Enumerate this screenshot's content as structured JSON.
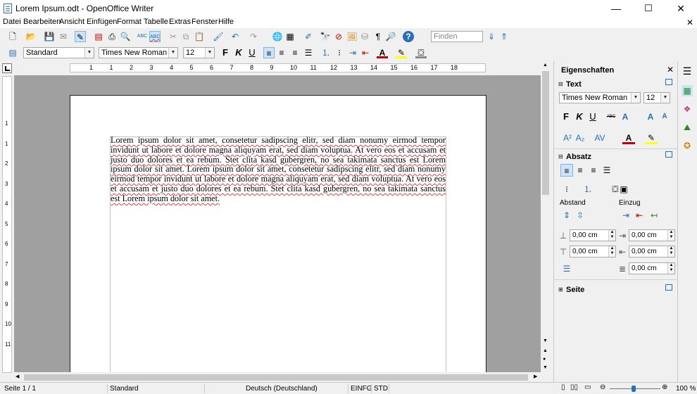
{
  "window": {
    "title": "Lorem Ipsum.odt - OpenOffice Writer",
    "minimize": "—",
    "maximize": "☐",
    "close": "✕",
    "doc_close": "✕"
  },
  "menu": [
    "Datei",
    "Bearbeiten",
    "Ansicht",
    "Einfügen",
    "Format",
    "Tabelle",
    "Extras",
    "Fenster",
    "Hilfe"
  ],
  "toolbar": {
    "find_placeholder": "Finden",
    "style": "Standard",
    "font": "Times New Roman",
    "size": "12",
    "bold": "F",
    "italic": "K",
    "underline": "U"
  },
  "ruler": {
    "labels": [
      "1",
      "1",
      "2",
      "3",
      "4",
      "5",
      "6",
      "7",
      "8",
      "9",
      "10",
      "11",
      "12",
      "13",
      "14",
      "15",
      "16",
      "17",
      "18"
    ]
  },
  "vruler": {
    "labels": [
      "1",
      "1",
      "2",
      "3",
      "4",
      "5",
      "6",
      "7",
      "8",
      "9",
      "10",
      "11"
    ]
  },
  "document": {
    "text": "Lorem ipsum dolor sit amet, consetetur sadipscing elitr, sed diam nonumy eirmod tempor invidunt ut labore et dolore magna aliquyam erat, sed diam voluptua. At vero eos et accusam et justo duo dolores et ea rebum. Stet clita kasd gubergren, no sea takimata sanctus est Lorem ipsum dolor sit amet. Lorem ipsum dolor sit amet, consetetur sadipscing elitr, sed diam nonumy eirmod tempor invidunt ut labore et dolore magna aliquyam erat, sed diam voluptua. At vero eos et accusam et justo duo dolores et ea rebum. Stet clita kasd gubergren, no sea takimata sanctus est Lorem ipsum dolor sit amet."
  },
  "sidebar": {
    "title": "Eigenschaften",
    "close": "✕",
    "text_section": "Text",
    "font": "Times New Roman",
    "size": "12",
    "bold": "F",
    "italic": "K",
    "underline": "U",
    "strike": "ABC",
    "absatz_section": "Absatz",
    "abstand_label": "Abstand",
    "einzug_label": "Einzug",
    "spacing_above": "0,00 cm",
    "spacing_below": "0,00 cm",
    "indent_before": "0,00 cm",
    "indent_after": "0,00 cm",
    "first_line": "0,00 cm",
    "seite_section": "Seite"
  },
  "status": {
    "page": "Seite 1 / 1",
    "style": "Standard",
    "language": "Deutsch (Deutschland)",
    "insert_mode": "EINFG",
    "selection_mode": "STD",
    "zoom": "100 %"
  },
  "colors": {
    "accent": "#2a6fb5",
    "spell_error": "#e04040",
    "font_color": "#c00000",
    "highlight": "#ffff00"
  }
}
